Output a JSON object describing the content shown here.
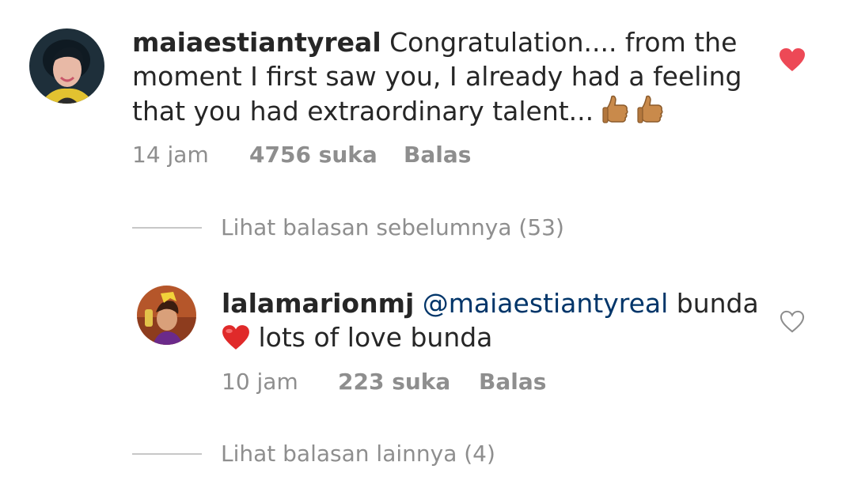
{
  "colors": {
    "liked_heart": "#ed4956",
    "meta_text": "#8e8e8e",
    "mention": "#003569"
  },
  "comments": [
    {
      "username": "maiaestiantyreal",
      "text": "Congratulation.... from the moment I first saw you, I already had a feeling that you had extraordinary talent...",
      "emoji": "thumbs-up-icon x2",
      "time": "14 jam",
      "likes": "4756 suka",
      "reply_label": "Balas",
      "liked": true,
      "view_replies": "Lihat balasan sebelumnya (53)"
    },
    {
      "username": "lalamarionmj",
      "mention": "@maiaestiantyreal",
      "text_before_emoji": "bunda",
      "emoji": "red-heart-icon",
      "text_after_emoji": "lots of love bunda",
      "time": "10 jam",
      "likes": "223 suka",
      "reply_label": "Balas",
      "liked": false,
      "view_replies": "Lihat balasan lainnya (4)"
    }
  ]
}
